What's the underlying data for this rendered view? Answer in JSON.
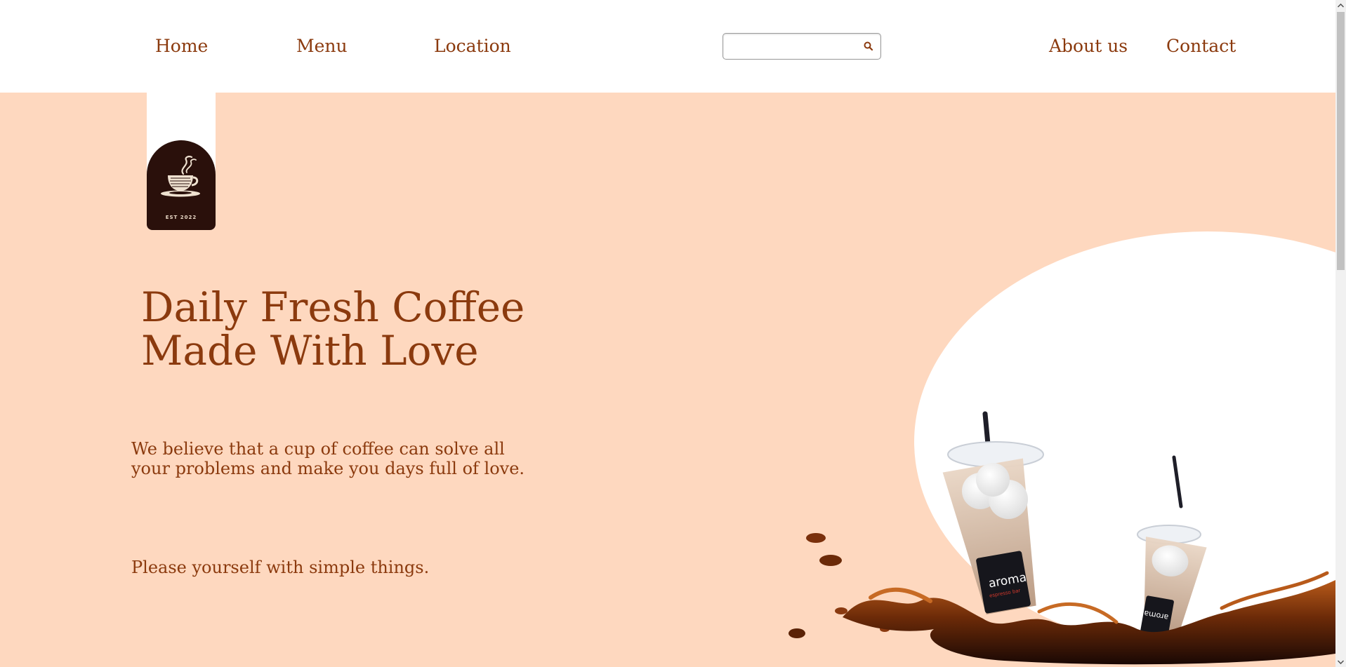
{
  "nav": {
    "home": "Home",
    "menu": "Menu",
    "location": "Location",
    "about": "About us",
    "contact": "Contact"
  },
  "search": {
    "value": "",
    "placeholder": "",
    "icon": "search-icon"
  },
  "logo": {
    "est": "EST 2022",
    "icon": "coffee-cup-icon"
  },
  "hero": {
    "headline_line1": "Daily Fresh Coffee",
    "headline_line2": "Made With Love",
    "tagline_line1": "We believe that a cup of coffee can solve all",
    "tagline_line2": "your problems and make you days full of love.",
    "subline": "Please yourself with simple things."
  },
  "product_image": {
    "cup_brand": "aroma",
    "cup_sub": "espresso bar"
  },
  "colors": {
    "accent": "#8b3a0e",
    "hero_bg": "#fed8bf",
    "logo_bg": "#2a100b",
    "header_bg": "#ffffff"
  }
}
